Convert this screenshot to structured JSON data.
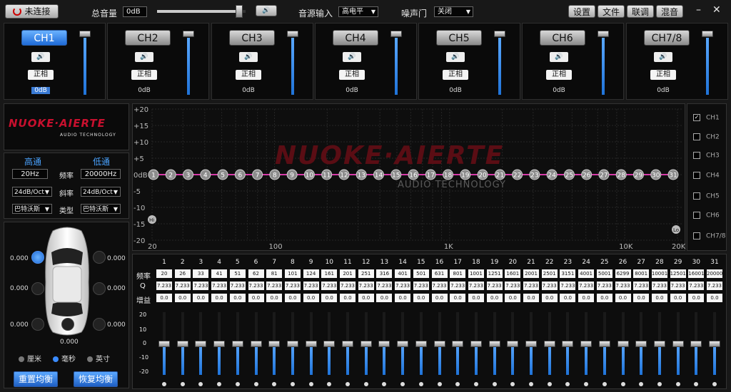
{
  "topbar": {
    "connect_label": "未连接",
    "master_volume_label": "总音量",
    "master_volume_value": "0dB",
    "master_volume_level": 1.0,
    "source_label": "音源输入",
    "source_value": "高电平",
    "noise_gate_label": "噪声门",
    "noise_gate_value": "关闭",
    "menu": [
      "设置",
      "文件",
      "联调",
      "混音"
    ],
    "minimize_glyph": "–",
    "close_glyph": "✕"
  },
  "channels": [
    {
      "name": "CH1",
      "speaker": "🔊",
      "phase": "正相",
      "gain": "0dB",
      "level": 1.0,
      "active": true
    },
    {
      "name": "CH2",
      "speaker": "🔊",
      "phase": "正相",
      "gain": "0dB",
      "level": 1.0,
      "active": false
    },
    {
      "name": "CH3",
      "speaker": "🔊",
      "phase": "正相",
      "gain": "0dB",
      "level": 1.0,
      "active": false
    },
    {
      "name": "CH4",
      "speaker": "🔊",
      "phase": "正相",
      "gain": "0dB",
      "level": 1.0,
      "active": false
    },
    {
      "name": "CH5",
      "speaker": "🔊",
      "phase": "正相",
      "gain": "0dB",
      "level": 1.0,
      "active": false
    },
    {
      "name": "CH6",
      "speaker": "🔊",
      "phase": "正相",
      "gain": "0dB",
      "level": 1.0,
      "active": false
    },
    {
      "name": "CH7/8",
      "speaker": "🔊",
      "phase": "正相",
      "gain": "0dB",
      "level": 1.0,
      "active": false
    }
  ],
  "brand": {
    "logo_text": "NUOKE·AIERTE",
    "sub_text": "AUDIO TECHNOLOGY",
    "color": "#c8102e"
  },
  "crossover": {
    "hp_label": "高通",
    "lp_label": "低通",
    "freq_label": "频率",
    "slope_label": "斜率",
    "type_label": "类型",
    "hp_freq": "20Hz",
    "lp_freq": "20000Hz",
    "hp_slope": "24dB/Oct",
    "lp_slope": "24dB/Oct",
    "hp_type": "巴特沃斯",
    "lp_type": "巴特沃斯"
  },
  "delay": {
    "seats": [
      {
        "value": "0.000",
        "on": true
      },
      {
        "value": "0.000",
        "on": false
      },
      {
        "value": "0.000",
        "on": false
      },
      {
        "value": "0.000",
        "on": false
      },
      {
        "value": "0.000",
        "on": false
      },
      {
        "value": "0.000",
        "on": false
      },
      {
        "value": "0.000",
        "on": false
      }
    ],
    "units": [
      {
        "label": "厘米",
        "on": false
      },
      {
        "label": "毫秒",
        "on": true
      },
      {
        "label": "英寸",
        "on": false
      }
    ],
    "reset_label": "重置均衡",
    "restore_label": "恢复均衡"
  },
  "graph": {
    "y_ticks": [
      "+20",
      "+15",
      "+10",
      "+5",
      "0dB",
      "-5",
      "-10",
      "-15",
      "-20"
    ],
    "x_ticks": [
      "20",
      "100",
      "1K",
      "10K",
      "20K"
    ],
    "left_marker": "Hi",
    "right_marker": "Lo",
    "curve_color": "#d63aa8",
    "point_count": 31
  },
  "channel_toggles": [
    {
      "label": "CH1",
      "checked": true
    },
    {
      "label": "CH2",
      "checked": false
    },
    {
      "label": "CH3",
      "checked": false
    },
    {
      "label": "CH4",
      "checked": false
    },
    {
      "label": "CH5",
      "checked": false
    },
    {
      "label": "CH6",
      "checked": false
    },
    {
      "label": "CH7/8",
      "checked": false
    }
  ],
  "eq": {
    "freq_label": "频率",
    "q_label": "Q",
    "gain_label": "增益",
    "scale": [
      "20",
      "10",
      "0",
      "-10",
      "-20"
    ],
    "freqs": [
      "20",
      "26",
      "33",
      "41",
      "51",
      "62",
      "81",
      "101",
      "124",
      "161",
      "201",
      "251",
      "316",
      "401",
      "501",
      "631",
      "801",
      "1001",
      "1251",
      "1601",
      "2001",
      "2501",
      "3151",
      "4001",
      "5001",
      "6299",
      "8001",
      "10001",
      "12501",
      "16001",
      "20000"
    ],
    "q_value": "7.233",
    "gain_value": "0.0",
    "slider_level": 0.5
  }
}
